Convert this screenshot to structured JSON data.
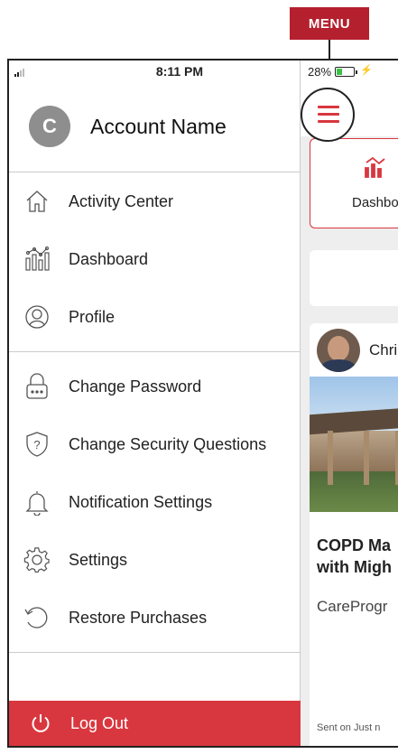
{
  "callout": {
    "label": "MENU"
  },
  "status_bar": {
    "time": "8:11 PM",
    "battery": "28%",
    "charging_symbol": "⚡"
  },
  "drawer": {
    "avatar_initial": "C",
    "account_name": "Account Name",
    "items": [
      {
        "label": "Activity Center",
        "icon": "home-icon"
      },
      {
        "label": "Dashboard",
        "icon": "dashboard-icon"
      },
      {
        "label": "Profile",
        "icon": "profile-icon"
      },
      {
        "label": "Change Password",
        "icon": "lock-icon"
      },
      {
        "label": "Change Security Questions",
        "icon": "shield-question-icon"
      },
      {
        "label": "Notification Settings",
        "icon": "bell-icon"
      },
      {
        "label": "Settings",
        "icon": "gear-icon"
      },
      {
        "label": "Restore Purchases",
        "icon": "restore-icon"
      }
    ],
    "logout_label": "Log Out"
  },
  "app": {
    "dashboard_tile_label": "Dashboard",
    "post_author": "Chri",
    "post_title": "COPD Ma\nwith Migh",
    "post_source": "CareProgr",
    "post_footer": "Sent on Just n"
  },
  "colors": {
    "accent": "#d9373f",
    "callout": "#b5202e",
    "divider": "#cccccc",
    "app_bg": "#eeeeee"
  }
}
